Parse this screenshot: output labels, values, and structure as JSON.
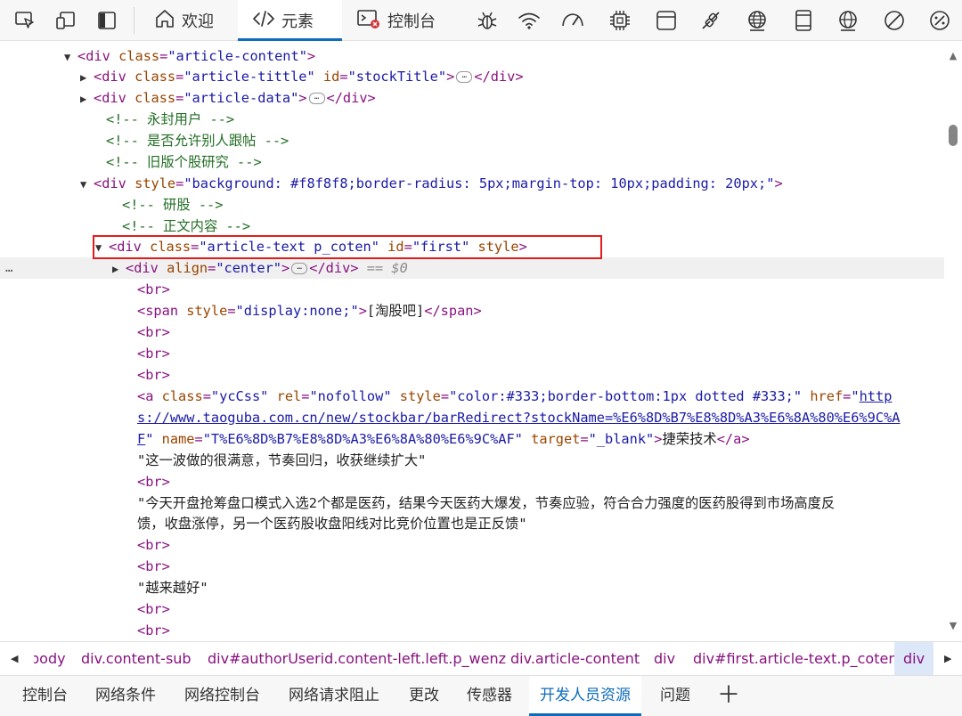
{
  "toolbar": {
    "icons_left": [
      "inspect-element-icon",
      "device-emulation-icon",
      "sidebar-toggle-icon"
    ],
    "tabs": [
      {
        "label": "欢迎",
        "icon": "home-icon",
        "active": false
      },
      {
        "label": "元素",
        "icon": "code-brackets-icon",
        "active": true
      },
      {
        "label": "控制台",
        "icon": "console-icon",
        "active": false
      }
    ],
    "icons_right": [
      "bug-icon",
      "wifi-icon",
      "performance-icon",
      "memory-chip-icon",
      "application-icon",
      "security-icon",
      "network-globe-icon",
      "device-icon",
      "rendering-globe-icon",
      "issues-blocked-icon",
      "settings-gauge-icon"
    ]
  },
  "code_lines": [
    {
      "name": "line-article-content",
      "parts": [
        [
          "tri",
          "▼"
        ],
        [
          "tag",
          "<div "
        ],
        [
          "an",
          "class"
        ],
        [
          "tag",
          "="
        ],
        [
          "av",
          "\"article-content\""
        ],
        [
          "tag",
          ">"
        ]
      ]
    },
    {
      "name": "line-article-tittle",
      "parts": [
        [
          "tri",
          "▶"
        ],
        [
          "tag",
          "<div "
        ],
        [
          "an",
          "class"
        ],
        [
          "tag",
          "="
        ],
        [
          "av",
          "\"article-tittle\""
        ],
        [
          "tag",
          " "
        ],
        [
          "an",
          "id"
        ],
        [
          "tag",
          "="
        ],
        [
          "av",
          "\"stockTitle\""
        ],
        [
          "tag",
          ">"
        ],
        [
          "ell",
          "…"
        ],
        [
          "tag",
          "</div>"
        ]
      ]
    },
    {
      "name": "line-article-data",
      "parts": [
        [
          "tri",
          "▶"
        ],
        [
          "tag",
          "<div "
        ],
        [
          "an",
          "class"
        ],
        [
          "tag",
          "="
        ],
        [
          "av",
          "\"article-data\""
        ],
        [
          "tag",
          ">"
        ],
        [
          "ell",
          "…"
        ],
        [
          "tag",
          "</div>"
        ]
      ]
    },
    {
      "name": "line-comment-1",
      "parts": [
        [
          "cm",
          "<!-- 永封用户 -->"
        ]
      ]
    },
    {
      "name": "line-comment-2",
      "parts": [
        [
          "cm",
          "<!-- 是否允许别人跟帖 -->"
        ]
      ]
    },
    {
      "name": "line-comment-3",
      "parts": [
        [
          "cm",
          "<!-- 旧版个股研究 -->"
        ]
      ]
    },
    {
      "name": "line-div-style",
      "parts": [
        [
          "tri",
          "▼"
        ],
        [
          "tag",
          "<div "
        ],
        [
          "an",
          "style"
        ],
        [
          "tag",
          "="
        ],
        [
          "av",
          "\"background: #f8f8f8;border-radius: 5px;margin-top: 10px;padding: 20px;\""
        ],
        [
          "tag",
          ">"
        ]
      ]
    },
    {
      "name": "line-comment-4",
      "parts": [
        [
          "cm",
          "<!-- 研股 -->"
        ]
      ]
    },
    {
      "name": "line-comment-5",
      "parts": [
        [
          "cm",
          "<!-- 正文内容 -->"
        ]
      ]
    },
    {
      "name": "line-article-text",
      "parts": [
        [
          "tri",
          "▼"
        ],
        [
          "tag",
          "<div "
        ],
        [
          "an",
          "class"
        ],
        [
          "tag",
          "="
        ],
        [
          "av",
          "\"article-text p_coten\""
        ],
        [
          "tag",
          " "
        ],
        [
          "an",
          "id"
        ],
        [
          "tag",
          "="
        ],
        [
          "av",
          "\"first\""
        ],
        [
          "tag",
          " "
        ],
        [
          "an",
          "style"
        ],
        [
          "tag",
          ">"
        ]
      ]
    },
    {
      "name": "line-div-center",
      "parts": [
        [
          "tri",
          "▶"
        ],
        [
          "tag",
          "<div "
        ],
        [
          "an",
          "align"
        ],
        [
          "tag",
          "="
        ],
        [
          "av",
          "\"center\""
        ],
        [
          "tag",
          ">"
        ],
        [
          "ell",
          "…"
        ],
        [
          "tag",
          "</div>"
        ],
        [
          "eq",
          " == $0"
        ]
      ]
    },
    {
      "name": "line-br-1",
      "parts": [
        [
          "tag",
          "<br>"
        ]
      ]
    },
    {
      "name": "line-span",
      "parts": [
        [
          "tag",
          "<span "
        ],
        [
          "an",
          "style"
        ],
        [
          "tag",
          "="
        ],
        [
          "av",
          "\"display:none;\""
        ],
        [
          "tag",
          ">"
        ],
        [
          "txt",
          "[淘股吧]"
        ],
        [
          "tag",
          "</span>"
        ]
      ]
    },
    {
      "name": "line-br-2",
      "parts": [
        [
          "tag",
          "<br>"
        ]
      ]
    },
    {
      "name": "line-br-3",
      "parts": [
        [
          "tag",
          "<br>"
        ]
      ]
    },
    {
      "name": "line-br-4",
      "parts": [
        [
          "tag",
          "<br>"
        ]
      ]
    },
    {
      "name": "line-anchor-1",
      "parts": [
        [
          "tag",
          "<a "
        ],
        [
          "an",
          "class"
        ],
        [
          "tag",
          "="
        ],
        [
          "av",
          "\"ycCss\""
        ],
        [
          "tag",
          " "
        ],
        [
          "an",
          "rel"
        ],
        [
          "tag",
          "="
        ],
        [
          "av",
          "\"nofollow\""
        ],
        [
          "tag",
          " "
        ],
        [
          "an",
          "style"
        ],
        [
          "tag",
          "="
        ],
        [
          "av",
          "\"color:#333;border-bottom:1px dotted #333;\""
        ],
        [
          "tag",
          " "
        ],
        [
          "an",
          "href"
        ],
        [
          "tag",
          "="
        ],
        [
          "av",
          "\""
        ],
        [
          "link",
          "http"
        ]
      ]
    },
    {
      "name": "line-anchor-2",
      "parts": [
        [
          "link",
          "s://www.taoguba.com.cn/new/stockbar/barRedirect?stockName=%E6%8D%B7%E8%8D%A3%E6%8A%80%E6%9C%A"
        ]
      ]
    },
    {
      "name": "line-anchor-3",
      "parts": [
        [
          "link",
          "F"
        ],
        [
          "av",
          "\""
        ],
        [
          "tag",
          " "
        ],
        [
          "an",
          "name"
        ],
        [
          "tag",
          "="
        ],
        [
          "av",
          "\"T%E6%8D%B7%E8%8D%A3%E6%8A%80%E6%9C%AF\""
        ],
        [
          "tag",
          " "
        ],
        [
          "an",
          "target"
        ],
        [
          "tag",
          "="
        ],
        [
          "av",
          "\"_blank\""
        ],
        [
          "tag",
          ">"
        ],
        [
          "txt",
          "捷荣技术"
        ],
        [
          "tag",
          "</a>"
        ]
      ]
    },
    {
      "name": "line-text-1",
      "parts": [
        [
          "txt",
          "\"这一波做的很满意，节奏回归，收获继续扩大\""
        ]
      ]
    },
    {
      "name": "line-br-5",
      "parts": [
        [
          "tag",
          "<br>"
        ]
      ]
    },
    {
      "name": "line-text-2a",
      "parts": [
        [
          "txt",
          "\"今天开盘抢筹盘口模式入选2个都是医药，结果今天医药大爆发，节奏应验，符合合力强度的医药股得到市场高度反"
        ]
      ]
    },
    {
      "name": "line-text-2b",
      "parts": [
        [
          "txt",
          "馈，收盘涨停，另一个医药股收盘阳线对比竞价位置也是正反馈\""
        ]
      ]
    },
    {
      "name": "line-br-6",
      "parts": [
        [
          "tag",
          "<br>"
        ]
      ]
    },
    {
      "name": "line-br-7",
      "parts": [
        [
          "tag",
          "<br>"
        ]
      ]
    },
    {
      "name": "line-text-3",
      "parts": [
        [
          "txt",
          "\"越来越好\""
        ]
      ]
    },
    {
      "name": "line-br-8",
      "parts": [
        [
          "tag",
          "<br>"
        ]
      ]
    },
    {
      "name": "line-br-9",
      "parts": [
        [
          "tag",
          "<br>"
        ]
      ]
    }
  ],
  "selected_marker": "…",
  "breadcrumbs": [
    "body",
    "div.content-sub",
    "div#authorUserid.content-left.left.p_wenz",
    "div.article-content",
    "div",
    "div#first.article-text.p_coten",
    "div"
  ],
  "drawer_tabs": [
    "控制台",
    "网络条件",
    "网络控制台",
    "网络请求阻止",
    "更改",
    "传感器",
    "开发人员资源",
    "问题"
  ],
  "drawer_active": "开发人员资源",
  "drawer_plus": "＋",
  "colors": {
    "tag": "#881280",
    "attr_name": "#994500",
    "attr_value": "#1a1aa6",
    "comment": "#236e25",
    "accent": "#0f6cbd",
    "highlight_box": "#e21c1c"
  }
}
